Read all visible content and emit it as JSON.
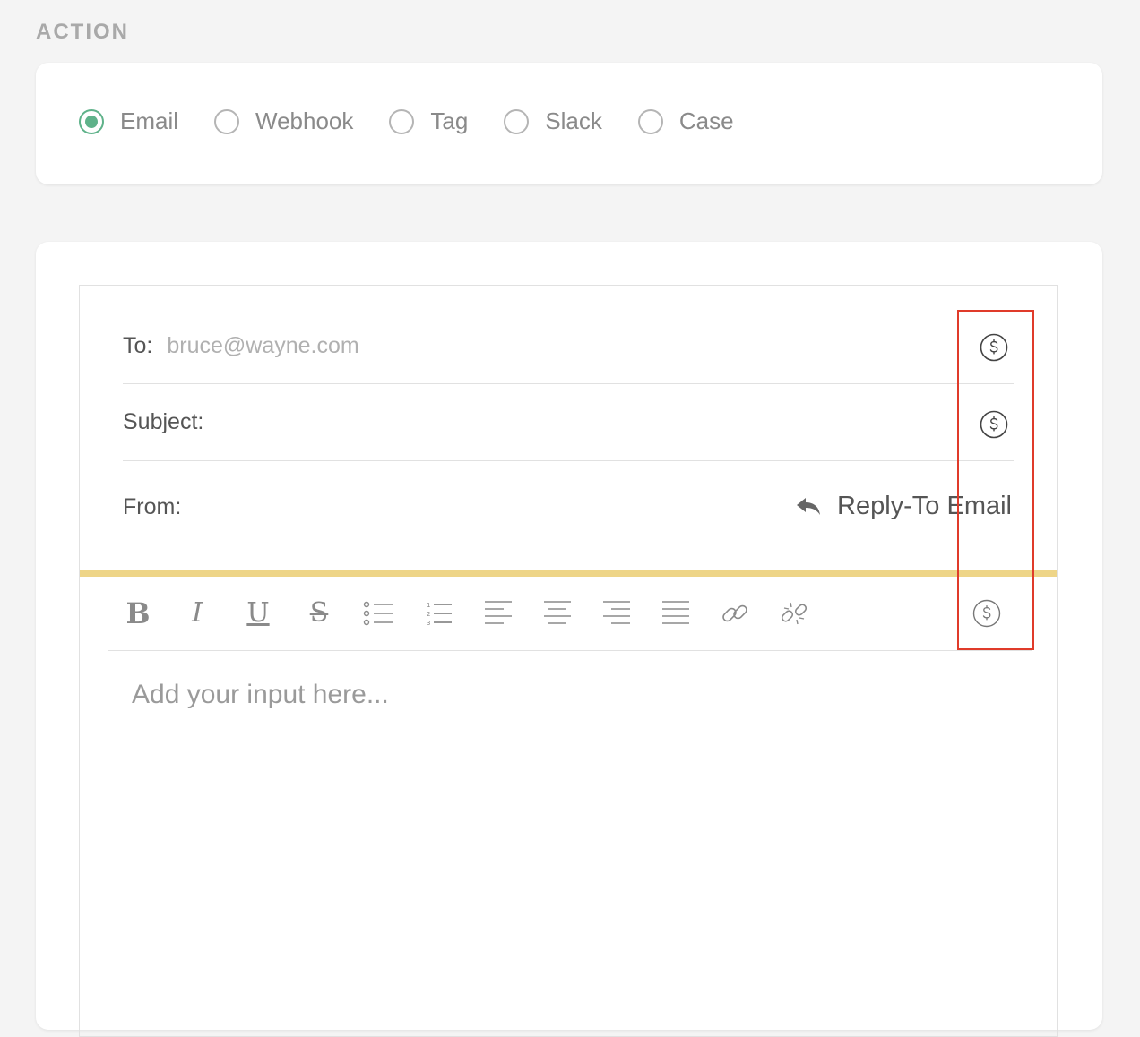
{
  "section": {
    "title": "ACTION"
  },
  "action_types": {
    "options": [
      {
        "label": "Email",
        "selected": true
      },
      {
        "label": "Webhook",
        "selected": false
      },
      {
        "label": "Tag",
        "selected": false
      },
      {
        "label": "Slack",
        "selected": false
      },
      {
        "label": "Case",
        "selected": false
      }
    ]
  },
  "email": {
    "to_label": "To:",
    "to_placeholder": "bruce@wayne.com",
    "to_value": "",
    "subject_label": "Subject:",
    "subject_value": "",
    "from_label": "From:",
    "reply_to_label": "Reply-To Email",
    "body_placeholder": "Add your input here..."
  },
  "icons": {
    "variable": "dollar-circle-icon",
    "reply": "reply-arrow-icon"
  },
  "toolbar": {
    "buttons": [
      "bold",
      "italic",
      "underline",
      "strikethrough",
      "bullet-list",
      "numbered-list",
      "align-left",
      "align-center",
      "align-right",
      "justify",
      "link",
      "unlink",
      "insert-variable"
    ]
  },
  "colors": {
    "accent": "#5fb28a",
    "editor_bar": "#eed588",
    "highlight": "#e03b2a"
  }
}
